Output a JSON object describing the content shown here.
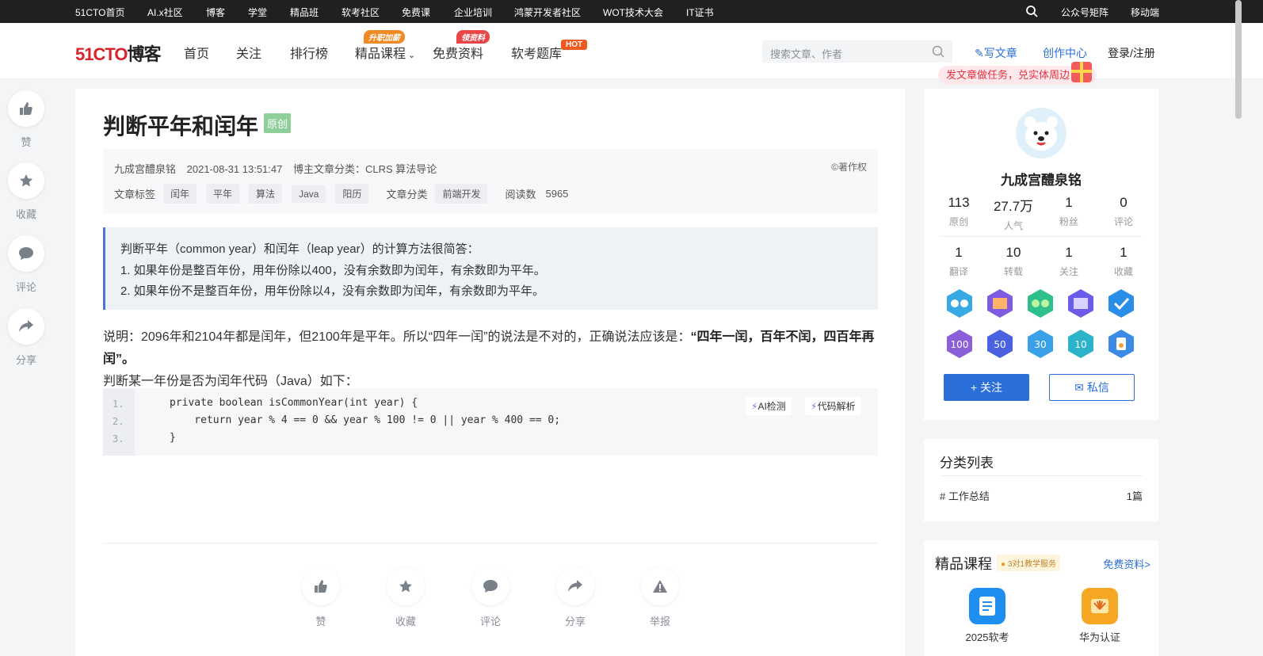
{
  "topbar": {
    "items": [
      "51CTO首页",
      "AI.x社区",
      "博客",
      "学堂",
      "精品班",
      "软考社区",
      "免费课",
      "企业培训",
      "鸿蒙开发者社区",
      "WOT技术大会",
      "IT证书"
    ],
    "right": [
      "公众号矩阵",
      "移动端"
    ]
  },
  "header": {
    "logo_red": "51CTO",
    "logo_rest": "博客",
    "nav": [
      "首页",
      "关注",
      "排行榜",
      "精品课程",
      "免费资料",
      "软考题库"
    ],
    "badges": {
      "courses": "升职加薪",
      "free": "领资料",
      "exam": "HOT"
    },
    "search_placeholder": "搜索文章、作者",
    "write": "写文章",
    "creator": "创作中心",
    "login": "登录/注册",
    "promo": "发文章做任务，兑实体周边"
  },
  "left_actions": [
    {
      "label": "赞",
      "icon": "thumbs-up-icon"
    },
    {
      "label": "收藏",
      "icon": "star-icon"
    },
    {
      "label": "评论",
      "icon": "comment-icon"
    },
    {
      "label": "分享",
      "icon": "share-icon"
    }
  ],
  "article": {
    "title": "判断平年和闰年",
    "badge": "原创",
    "author": "九成宫醴泉铭",
    "date": "2021-08-31 13:51:47",
    "blog_category_label": "博主文章分类：",
    "blog_category": "CLRS 算法导论",
    "copyright": "©著作权",
    "tags_label": "文章标签",
    "tags": [
      "闰年",
      "平年",
      "算法",
      "Java",
      "阳历"
    ],
    "category_label": "文章分类",
    "category": "前端开发",
    "reads_label": "阅读数",
    "reads": "5965",
    "quote": [
      "判断平年（common year）和闰年（leap year）的计算方法很简答：",
      "1. 如果年份是整百年份，用年份除以400，没有余数即为闰年，有余数即为平年。",
      "2. 如果年份不是整百年份，用年份除以4，没有余数即为闰年，有余数即为平年。"
    ],
    "para1_normal": "说明：2096年和2104年都是闰年，但2100年是平年。所以“四年一闰”的说法是不对的，正确说法应该是：",
    "para1_bold": "“四年一闰，百年不闰，四百年再",
    "para1_bold2": "闰”。",
    "para2": "判断某一年份是否为闰年代码（Java）如下：",
    "code_lines": [
      "private boolean isCommonYear(int year) {",
      "    return year % 4 == 0 && year % 100 != 0 || year % 400 == 0;",
      "}"
    ],
    "line_numbers": [
      "1.",
      "2.",
      "3."
    ],
    "ai_check": "AI检测",
    "code_explain": "代码解析",
    "bottom_actions": [
      "赞",
      "收藏",
      "评论",
      "分享",
      "举报"
    ]
  },
  "profile": {
    "name": "九成宫醴泉铭",
    "stats_row1": [
      {
        "value": "113",
        "label": "原创"
      },
      {
        "value": "27.7万",
        "label": "人气"
      },
      {
        "value": "1",
        "label": "粉丝"
      },
      {
        "value": "0",
        "label": "评论"
      }
    ],
    "stats_row2": [
      {
        "value": "1",
        "label": "翻译"
      },
      {
        "value": "10",
        "label": "转载"
      },
      {
        "value": "1",
        "label": "关注"
      },
      {
        "value": "1",
        "label": "收藏"
      }
    ],
    "medals_row2": [
      "100",
      "50",
      "30",
      "10"
    ],
    "follow": "+ 关注",
    "message": "私信"
  },
  "categories": {
    "title": "分类列表",
    "items": [
      {
        "name": "# 工作总结",
        "count": "1篇"
      }
    ]
  },
  "courses": {
    "title": "精品课程",
    "badge": "3对1教学服务",
    "more": "免费资料>",
    "items": [
      "2025软考",
      "华为认证"
    ]
  },
  "colors": {
    "accent": "#2a6ed8",
    "brand_red": "#d8232a",
    "quote_border": "#4a78c8"
  }
}
